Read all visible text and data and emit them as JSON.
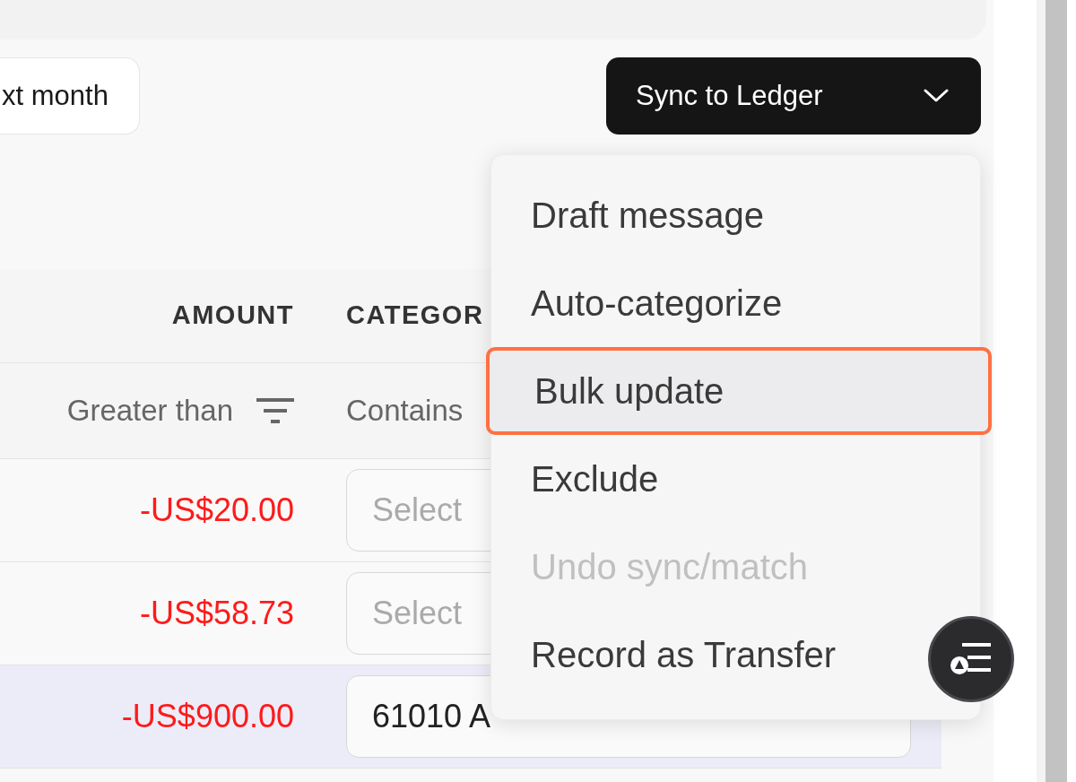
{
  "toolbar": {
    "month_button": "xt month",
    "sync_button": "Sync to Ledger"
  },
  "table": {
    "columns": [
      {
        "label": "AMOUNT",
        "filter": "Greater than"
      },
      {
        "label": "CATEGOR",
        "filter": "Contains"
      }
    ],
    "rows": [
      {
        "amount": "-US$20.00",
        "category": {
          "placeholder": "Select"
        },
        "selected": false
      },
      {
        "amount": "-US$58.73",
        "category": {
          "placeholder": "Select"
        },
        "selected": false
      },
      {
        "amount": "-US$900.00",
        "category": {
          "value": "61010 A"
        },
        "selected": true
      }
    ]
  },
  "menu": {
    "items": [
      {
        "label": "Draft message",
        "highlighted": false,
        "disabled": false
      },
      {
        "label": "Auto-categorize",
        "highlighted": false,
        "disabled": false
      },
      {
        "label": "Bulk update",
        "highlighted": true,
        "disabled": false
      },
      {
        "label": "Exclude",
        "highlighted": false,
        "disabled": false
      },
      {
        "label": "Undo sync/match",
        "highlighted": false,
        "disabled": true
      },
      {
        "label": "Record as Transfer",
        "highlighted": false,
        "disabled": false
      }
    ]
  }
}
